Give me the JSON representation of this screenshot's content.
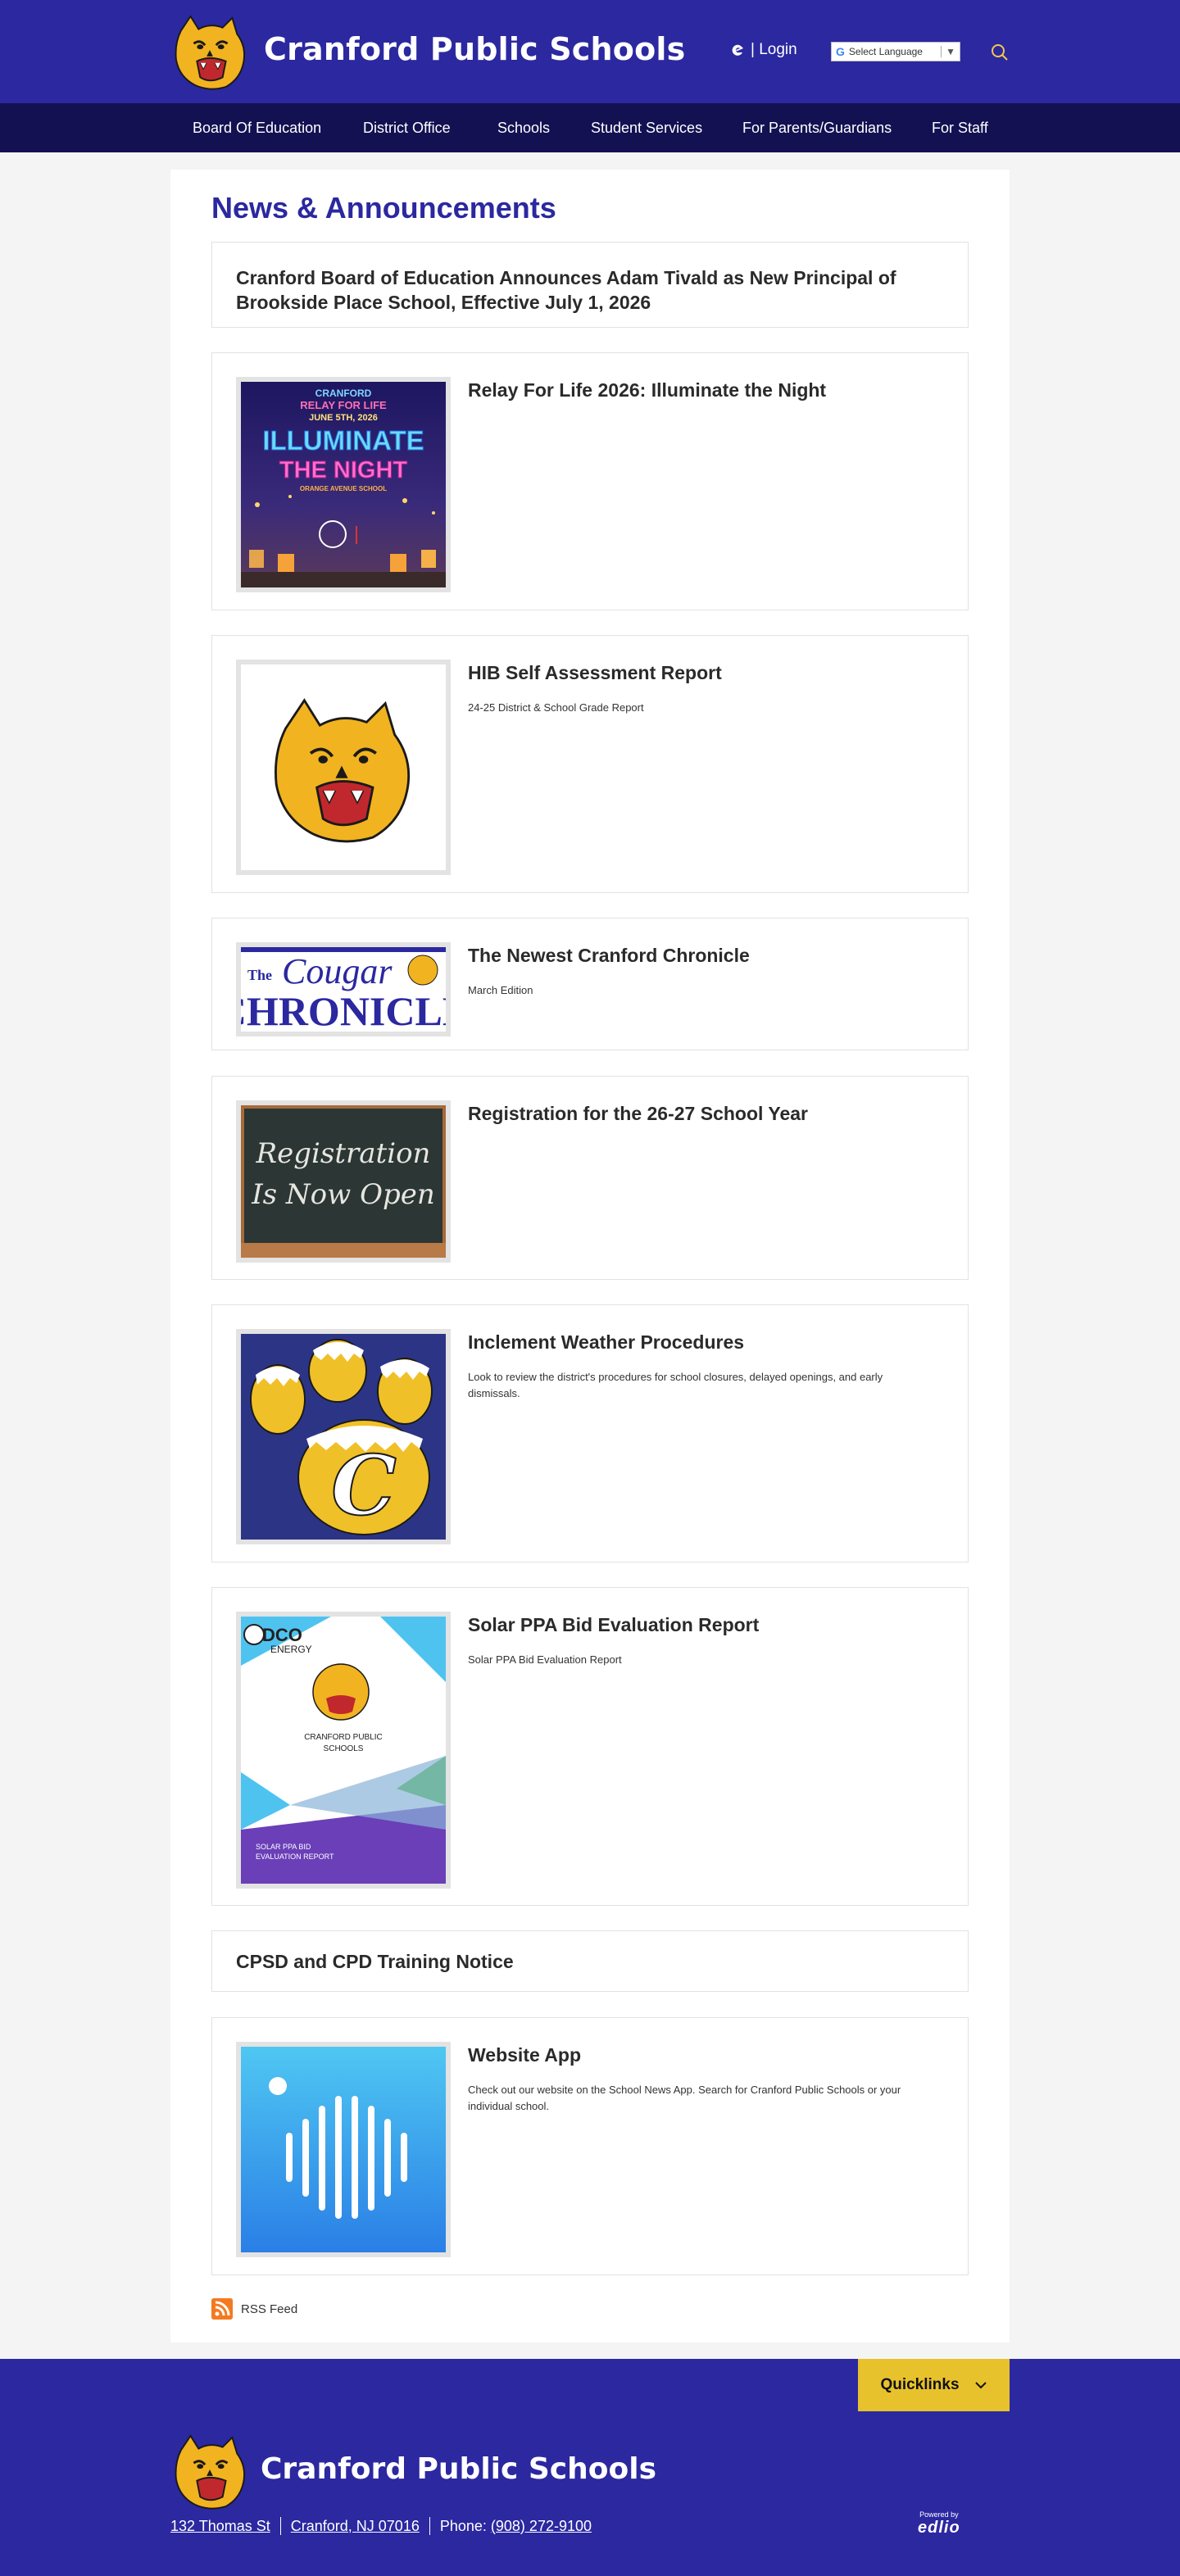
{
  "header": {
    "site_title": "Cranford Public Schools",
    "login_label": "| Login",
    "language_label": "Select Language",
    "language_arrow": "▼"
  },
  "nav": {
    "items": [
      "Board Of Education",
      "District Office",
      "Schools",
      "Student Services",
      "For Parents/Guardians",
      "For Staff"
    ]
  },
  "main": {
    "title": "News & Announcements",
    "cards": [
      {
        "title": "Cranford Board of Education Announces Adam Tivald as New Principal of Brookside Place School, Effective July 1, 2026",
        "description": ""
      },
      {
        "title": "Relay For Life 2026: Illuminate the Night",
        "description": "",
        "image_text": {
          "line1": "CRANFORD",
          "line2": "RELAY FOR LIFE",
          "line3": "JUNE 5TH, 2026",
          "line4": "ILLUMINATE",
          "line5": "THE NIGHT",
          "line6": "ORANGE AVENUE SCHOOL"
        }
      },
      {
        "title": "HIB Self Assessment Report",
        "description": "24-25 District & School Grade Report"
      },
      {
        "title": "The Newest Cranford Chronicle",
        "description": "March Edition",
        "image_text": {
          "the": "The",
          "cougar": "Cougar",
          "chronicle": "CHRONICLE"
        }
      },
      {
        "title": "Registration for the 26-27 School Year",
        "description": "",
        "image_text": {
          "line1": "Registration",
          "line2": "Is Now Open"
        }
      },
      {
        "title": "Inclement Weather Procedures",
        "description": "Look to review the district's procedures for school closures, delayed openings, and early dismissals.",
        "image_text": {
          "letter": "C"
        }
      },
      {
        "title": "Solar PPA Bid Evaluation Report",
        "description": "Solar PPA Bid Evaluation Report",
        "image_text": {
          "brand1": "DCO",
          "brand2": "ENERGY",
          "school1": "CRANFORD PUBLIC",
          "school2": "SCHOOLS",
          "report1": "SOLAR PPA BID",
          "report2": "EVALUATION REPORT"
        }
      },
      {
        "title": "CPSD and CPD Training Notice",
        "description": ""
      },
      {
        "title": "Website App",
        "description": "Check out our website on the School News App. Search for Cranford Public Schools or your individual school."
      }
    ],
    "rss_label": "RSS Feed"
  },
  "footer": {
    "quicklinks_label": "Quicklinks",
    "site_title": "Cranford Public Schools",
    "address": "132 Thomas St",
    "city": "Cranford, NJ 07016",
    "phone_prefix": "Phone: ",
    "phone": "(908) 272-9100",
    "powered_by": "Powered by",
    "brand": "edlio"
  },
  "colors": {
    "primary": "#2b28a0",
    "nav": "#131152",
    "accent": "#e8c22c"
  },
  "icons": [
    "cougar-logo",
    "edlio-e-icon",
    "google-icon",
    "search-icon",
    "rss-icon",
    "chevron-down-icon"
  ]
}
